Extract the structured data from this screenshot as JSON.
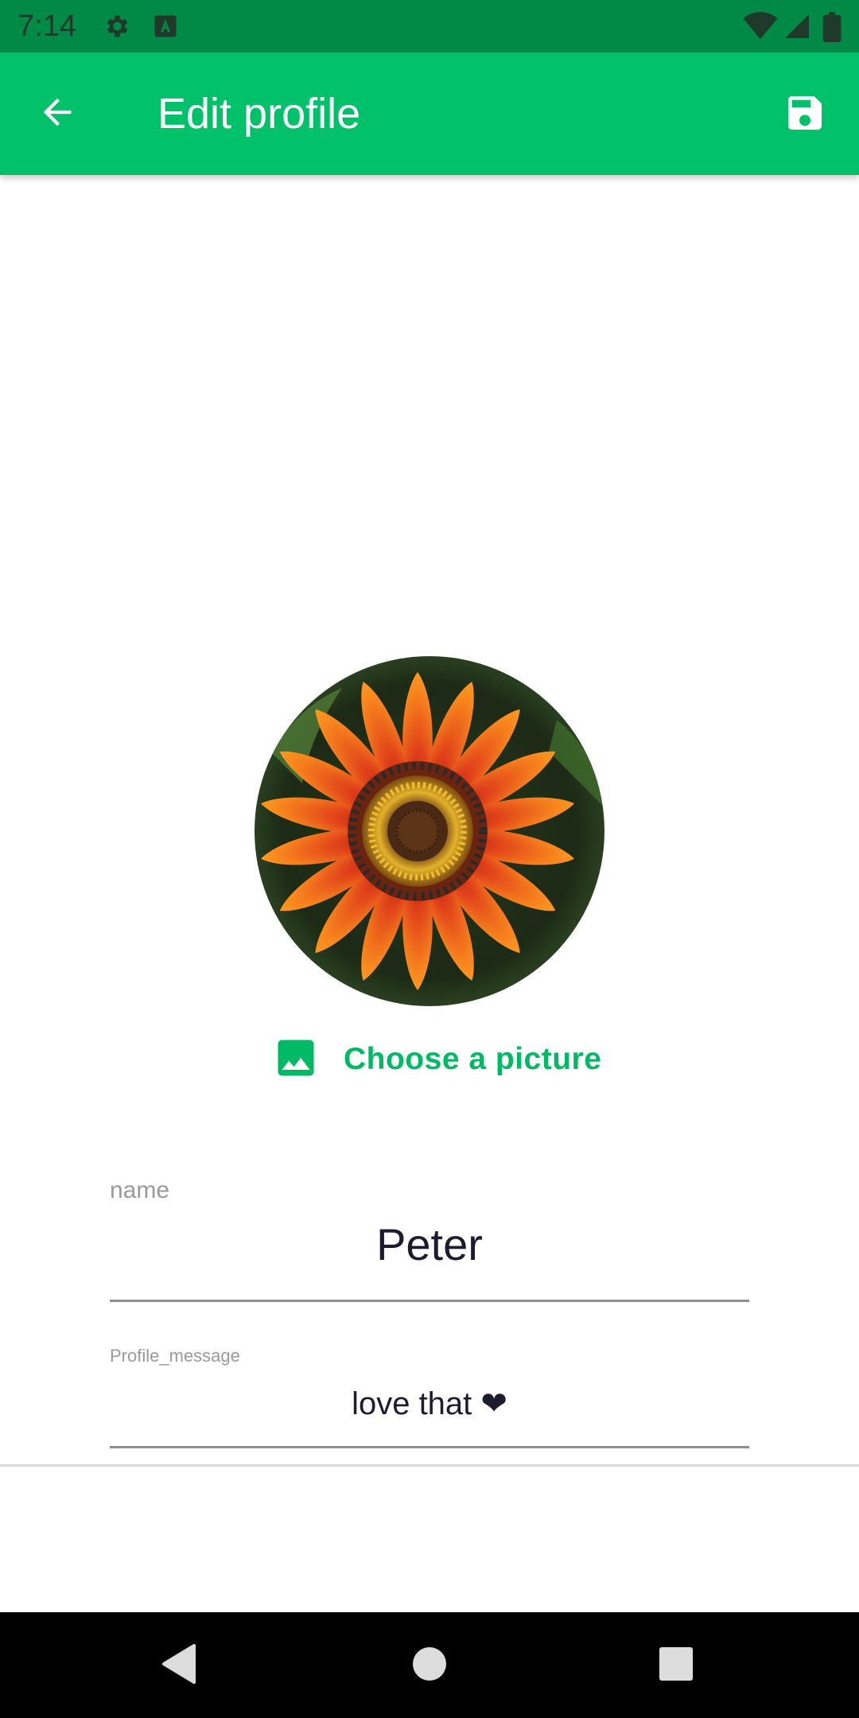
{
  "status_bar": {
    "time": "7:14",
    "icons": [
      "settings-icon",
      "keyboard-a-icon",
      "wifi-icon",
      "cell-signal-icon",
      "battery-icon"
    ]
  },
  "app_bar": {
    "title": "Edit profile",
    "back_icon": "arrow-back-icon",
    "save_icon": "save-floppy-icon",
    "color": "#00c16a"
  },
  "avatar": {
    "description_icon": "flower-photo"
  },
  "choose_picture": {
    "label": "Choose a picture",
    "icon": "image-icon",
    "color": "#00b964"
  },
  "form": {
    "name": {
      "label": "name",
      "value": "Peter"
    },
    "profile_message": {
      "label": "Profile_message",
      "value": "love that ❤"
    }
  },
  "nav_bar": {
    "icons": [
      "back-triangle-icon",
      "home-circle-icon",
      "recents-square-icon"
    ]
  },
  "colors": {
    "status_bar": "#008a45",
    "accent": "#00c16a",
    "text_dark": "#1c1c2e"
  }
}
